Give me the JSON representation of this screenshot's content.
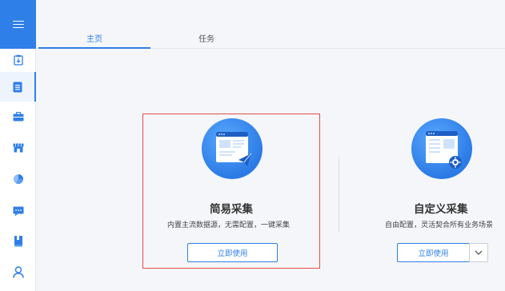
{
  "tabs": [
    {
      "label": "主页",
      "active": true
    },
    {
      "label": "任务",
      "active": false
    }
  ],
  "sidebar": {
    "items": [
      {
        "icon": "clipboard-download-icon"
      },
      {
        "icon": "document-list-icon",
        "active": true
      },
      {
        "icon": "briefcase-icon"
      },
      {
        "icon": "store-icon"
      },
      {
        "icon": "pie-chart-icon"
      },
      {
        "icon": "chat-bubble-icon"
      },
      {
        "icon": "book-icon"
      },
      {
        "icon": "user-icon"
      }
    ]
  },
  "cards": {
    "simple": {
      "title": "简易采集",
      "desc": "内置主流数据源，无需配置，一键采集",
      "button": "立即使用"
    },
    "custom": {
      "title": "自定义采集",
      "desc": "自由配置，灵活契合所有业务场景",
      "button": "立即使用"
    }
  },
  "colors": {
    "accent": "#2f7fe8",
    "highlight_border": "#e64c4c"
  }
}
